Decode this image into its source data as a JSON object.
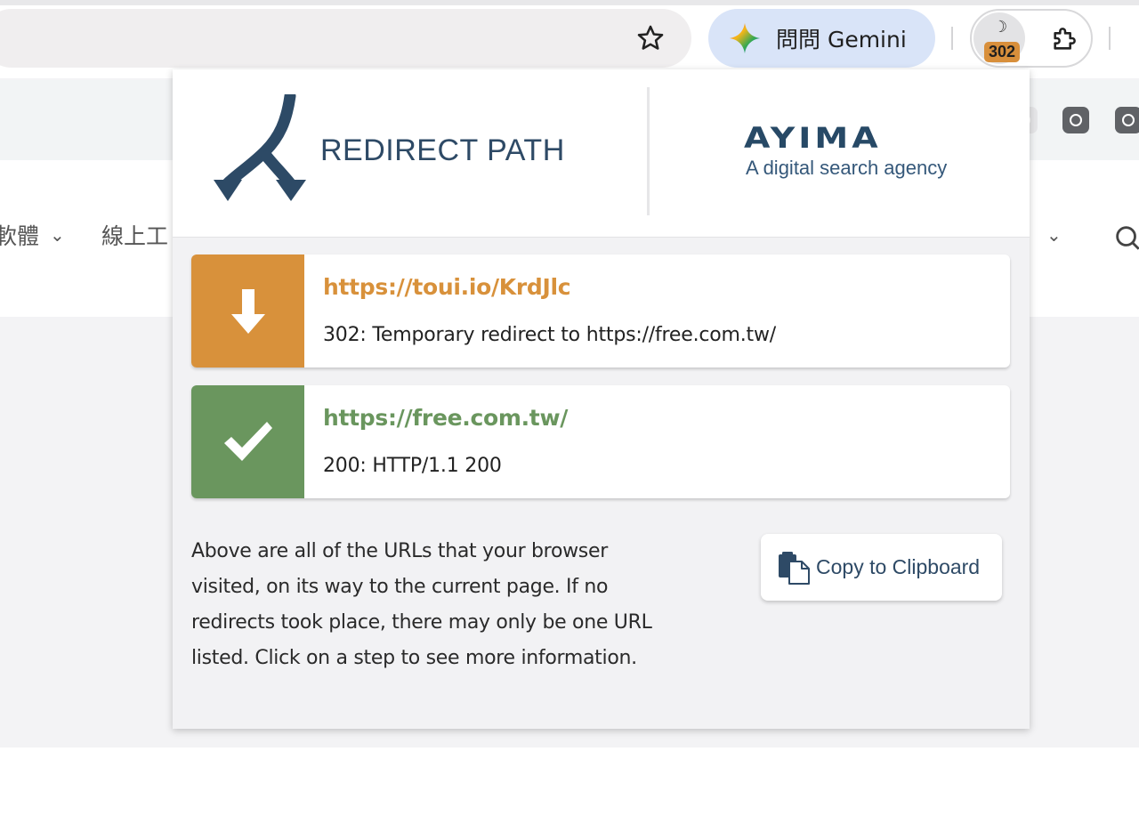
{
  "browser": {
    "gemini_label": "問問 Gemini",
    "extension_badge": "302",
    "icons": [
      "star-icon",
      "gemini-icon",
      "redirect-path-extension-icon",
      "puzzle-icon"
    ]
  },
  "page": {
    "nav_item_1": "軟體",
    "nav_item_2": "線上工"
  },
  "popup": {
    "logo_title": "REDIRECT PATH",
    "ayima_brand": "AYIMA",
    "ayima_tagline": "A digital search agency",
    "steps": [
      {
        "url": "https://toui.io/KrdJlc",
        "status": "302: Temporary redirect to https://free.com.tw/",
        "color": "#d8913b",
        "icon": "arrow-down-icon"
      },
      {
        "url": "https://free.com.tw/",
        "status": "200: HTTP/1.1 200",
        "color": "#6a965e",
        "icon": "check-icon"
      }
    ],
    "info_text": "Above are all of the URLs that your browser visited, on its way to the current page. If no redirects took place, there may only be one URL listed. Click on a step to see more information.",
    "copy_label": "Copy to Clipboard"
  }
}
